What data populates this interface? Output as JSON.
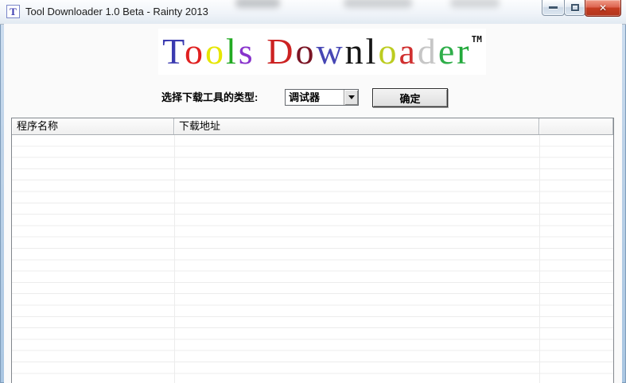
{
  "window": {
    "title": "Tool Downloader 1.0 Beta - Rainty 2013",
    "icon_letter": "T",
    "controls": [
      {
        "icon": "minimize-icon"
      },
      {
        "icon": "maximize-icon"
      },
      {
        "icon": "close-icon",
        "glyph": "✕"
      }
    ]
  },
  "logo": {
    "letters": [
      {
        "ch": "T",
        "color": "#3b3bb0"
      },
      {
        "ch": "o",
        "color": "#e02020"
      },
      {
        "ch": "o",
        "color": "#e6e600"
      },
      {
        "ch": "l",
        "color": "#22aa22"
      },
      {
        "ch": "s",
        "color": "#8833cc"
      },
      {
        "ch": " ",
        "color": "#000000"
      },
      {
        "ch": "D",
        "color": "#cc2222"
      },
      {
        "ch": "o",
        "color": "#7a1424"
      },
      {
        "ch": "w",
        "color": "#4646b4"
      },
      {
        "ch": "n",
        "color": "#161616"
      },
      {
        "ch": "l",
        "color": "#161616"
      },
      {
        "ch": "o",
        "color": "#bccc20"
      },
      {
        "ch": "a",
        "color": "#d03030"
      },
      {
        "ch": "d",
        "color": "#c6c6c6"
      },
      {
        "ch": "e",
        "color": "#2fae4a"
      },
      {
        "ch": "r",
        "color": "#23a93c"
      }
    ],
    "trademark": "TM"
  },
  "toolbar": {
    "type_label": "选择下载工具的类型:",
    "type_select_value": "调试器",
    "confirm_label": "确定"
  },
  "list": {
    "columns": [
      "程序名称",
      "下载地址",
      ""
    ],
    "rows": []
  },
  "colors": {
    "close_button_red": "#c63d22",
    "window_border_blue": "#a9c6e2",
    "titlebar_background": "#f0f4f9",
    "client_background": "#fafafa",
    "header_background": "#efefef",
    "gridline": "#ececec"
  }
}
